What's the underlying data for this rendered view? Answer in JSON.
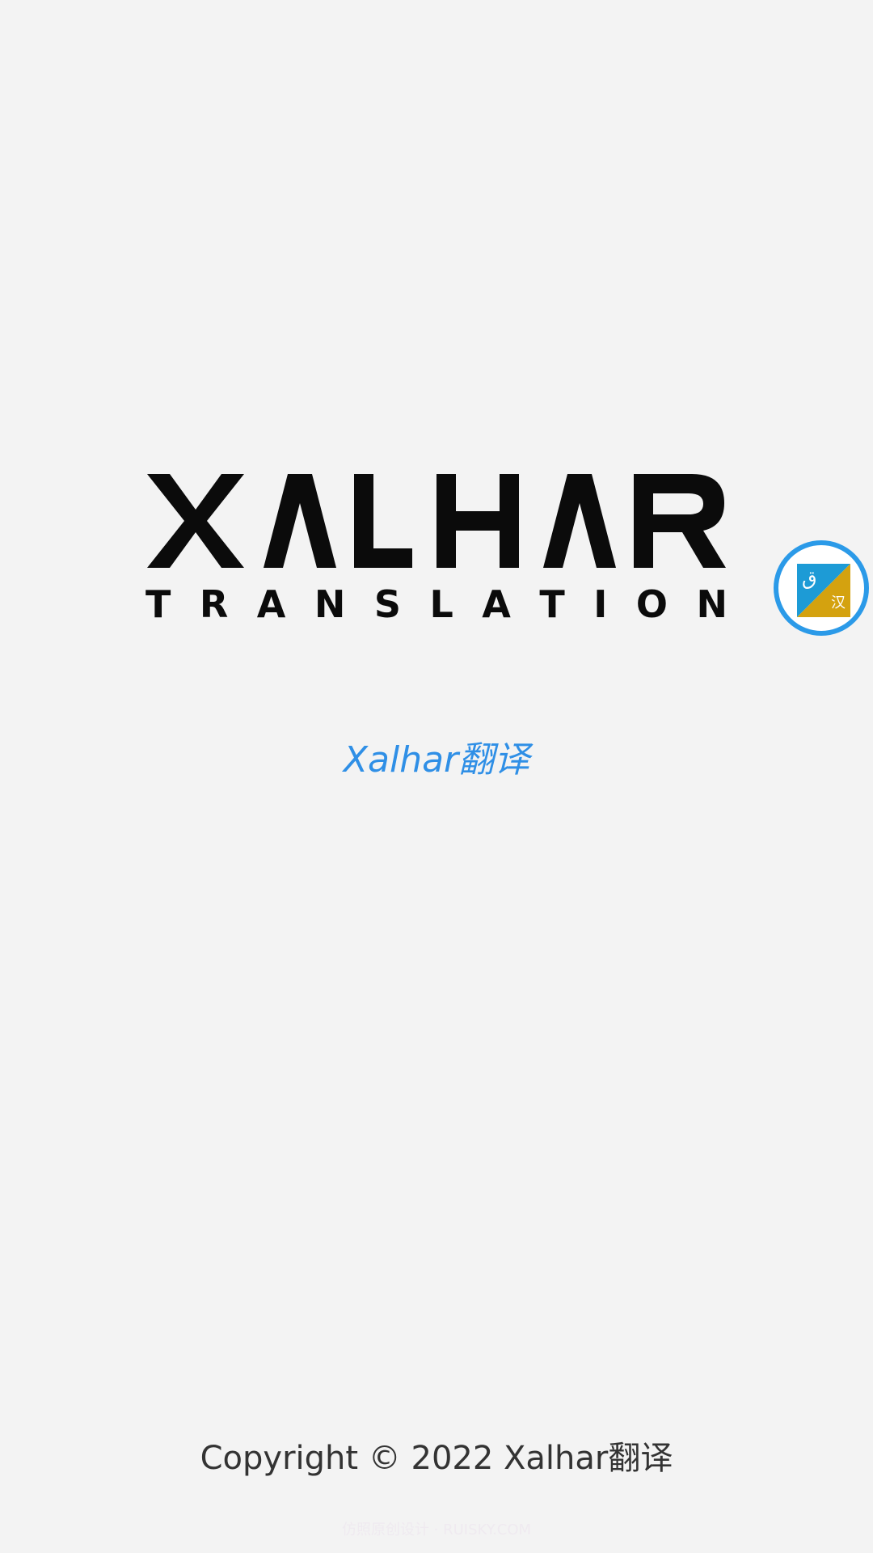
{
  "logo": {
    "wordmark": "XALHAR",
    "subtitle_letters": [
      "T",
      "R",
      "A",
      "N",
      "S",
      "L",
      "A",
      "T",
      "I",
      "O",
      "N"
    ]
  },
  "app_name": "Xalhar翻译",
  "floating_button": {
    "icon": "language-translate-icon",
    "glyph_primary": "ق",
    "glyph_secondary": "汉",
    "colors": {
      "ring": "#2b9ae8",
      "top_left": "#1d9bd6",
      "bottom_right": "#d4a20f"
    }
  },
  "footer": {
    "copyright": "Copyright © 2022 Xalhar翻译"
  },
  "watermark": "仿照原创设计 · RUISKY.COM",
  "colors": {
    "background": "#f3f3f3",
    "accent": "#2f8fe6",
    "logo": "#0b0b0b"
  }
}
